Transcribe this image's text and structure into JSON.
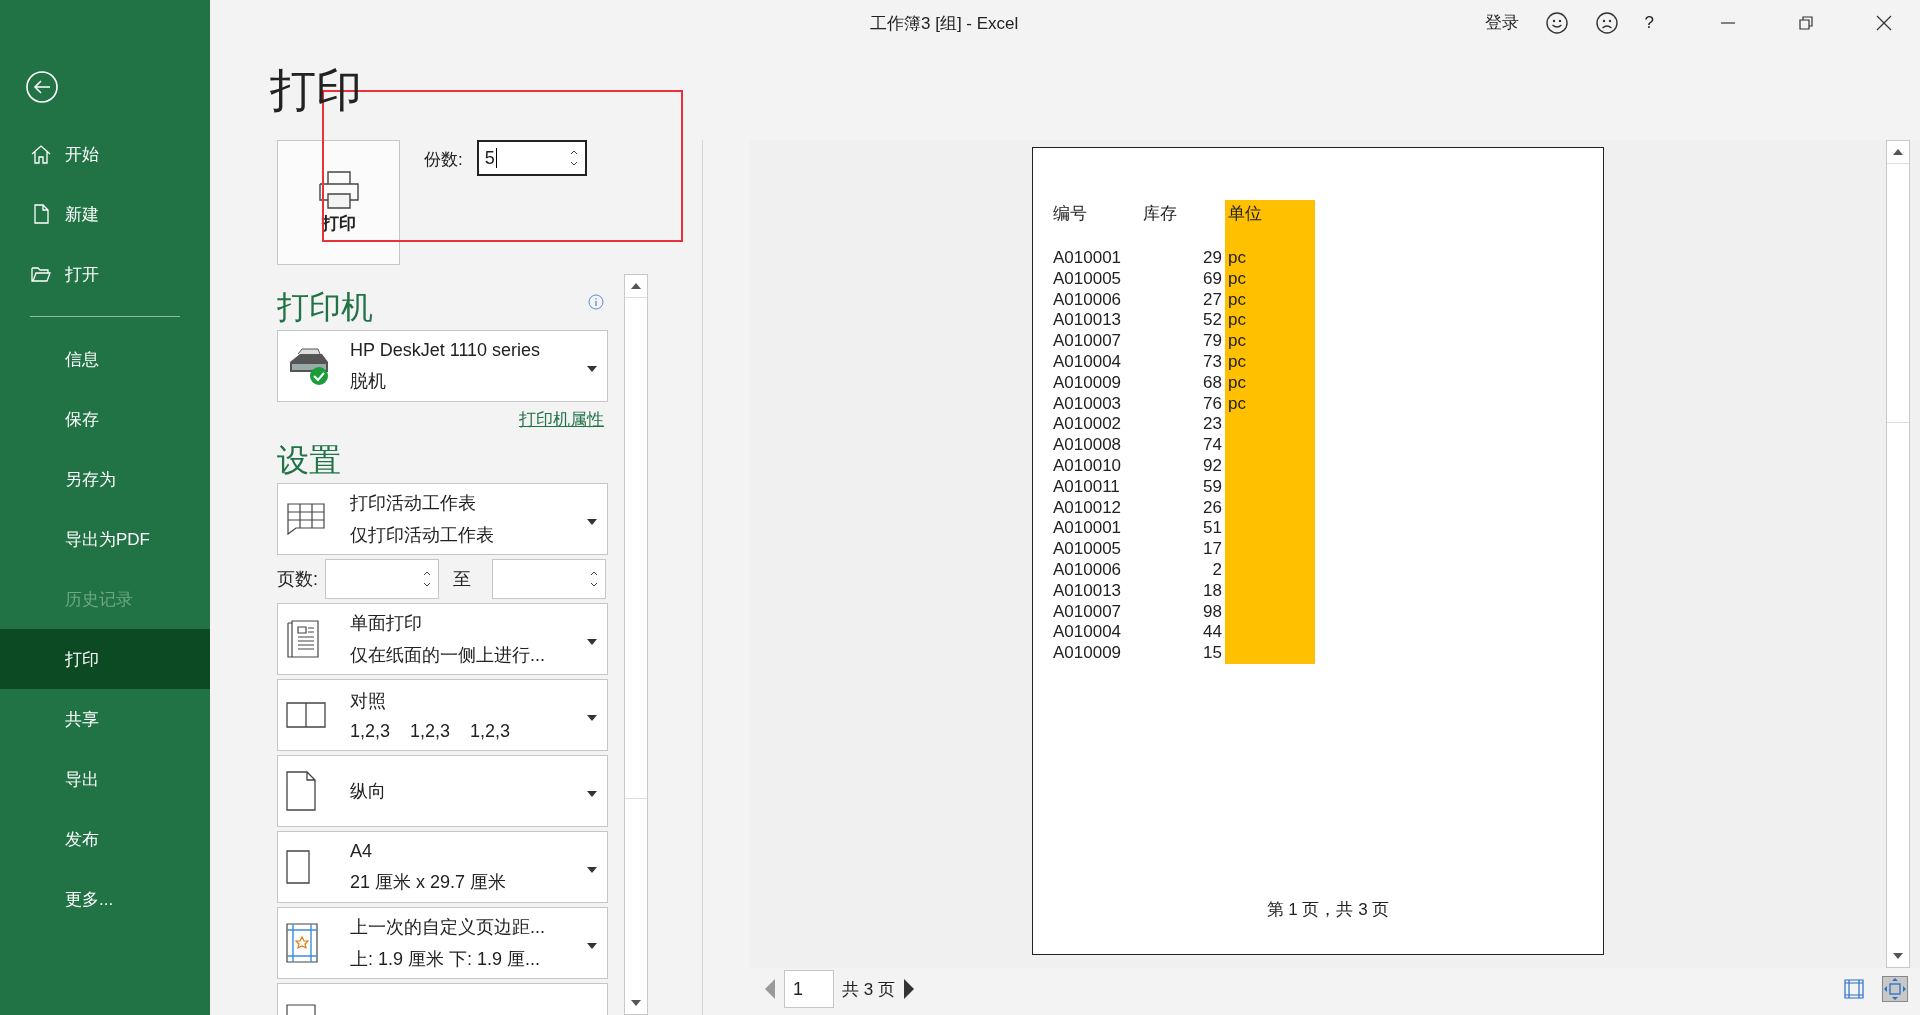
{
  "title_bar": {
    "title": "工作簿3  [组]  -  Excel",
    "sign_in": "登录",
    "help": "?"
  },
  "sidebar": {
    "top_items": [
      {
        "kind": "home",
        "label": "开始",
        "selected": false,
        "disabled": false
      },
      {
        "kind": "new",
        "label": "新建",
        "selected": false,
        "disabled": false
      },
      {
        "kind": "open",
        "label": "打开",
        "selected": false,
        "disabled": false
      }
    ],
    "items": [
      {
        "label": "信息",
        "selected": false,
        "disabled": false
      },
      {
        "label": "保存",
        "selected": false,
        "disabled": false
      },
      {
        "label": "另存为",
        "selected": false,
        "disabled": false
      },
      {
        "label": "导出为PDF",
        "selected": false,
        "disabled": false
      },
      {
        "label": "历史记录",
        "selected": false,
        "disabled": true
      },
      {
        "label": "打印",
        "selected": true,
        "disabled": false
      },
      {
        "label": "共享",
        "selected": false,
        "disabled": false
      },
      {
        "label": "导出",
        "selected": false,
        "disabled": false
      },
      {
        "label": "发布",
        "selected": false,
        "disabled": false
      },
      {
        "label": "更多...",
        "selected": false,
        "disabled": false
      }
    ]
  },
  "print": {
    "title": "打印",
    "print_button": "打印",
    "copies": {
      "label": "份数:",
      "value": "5"
    }
  },
  "printer": {
    "heading": "打印机",
    "name": "HP DeskJet 1110 series",
    "status": "脱机",
    "properties_link": "打印机属性"
  },
  "settings": {
    "heading": "设置",
    "pages": {
      "label": "页数:",
      "to_label": "至"
    },
    "options": [
      {
        "kind": "sheet",
        "line1": "打印活动工作表",
        "line2": "仅打印活动工作表"
      },
      {
        "kind": "pages"
      },
      {
        "kind": "sides",
        "line1": "单面打印",
        "line2": "仅在纸面的一侧上进行..."
      },
      {
        "kind": "collate",
        "line1": "对照",
        "line2": "1,2,3    1,2,3    1,2,3"
      },
      {
        "kind": "orientation",
        "line1": "纵向"
      },
      {
        "kind": "paper",
        "line1": "A4",
        "line2": "21 厘米 x 29.7 厘米"
      },
      {
        "kind": "margins",
        "line1": "上一次的自定义页边距...",
        "line2": "上: 1.9 厘米 下: 1.9 厘..."
      },
      {
        "kind": "scaling"
      }
    ]
  },
  "preview": {
    "columns": [
      "编号",
      "库存",
      "单位"
    ],
    "rows": [
      {
        "id": "A010001",
        "qty": "29",
        "unit": "pc"
      },
      {
        "id": "A010005",
        "qty": "69",
        "unit": "pc"
      },
      {
        "id": "A010006",
        "qty": "27",
        "unit": "pc"
      },
      {
        "id": "A010013",
        "qty": "52",
        "unit": "pc"
      },
      {
        "id": "A010007",
        "qty": "79",
        "unit": "pc"
      },
      {
        "id": "A010004",
        "qty": "73",
        "unit": "pc"
      },
      {
        "id": "A010009",
        "qty": "68",
        "unit": "pc"
      },
      {
        "id": "A010003",
        "qty": "76",
        "unit": "pc"
      },
      {
        "id": "A010002",
        "qty": "23"
      },
      {
        "id": "A010008",
        "qty": "74"
      },
      {
        "id": "A010010",
        "qty": "92"
      },
      {
        "id": "A010011",
        "qty": "59"
      },
      {
        "id": "A010012",
        "qty": "26"
      },
      {
        "id": "A010001",
        "qty": "51"
      },
      {
        "id": "A010005",
        "qty": "17"
      },
      {
        "id": "A010006",
        "qty": "2"
      },
      {
        "id": "A010013",
        "qty": "18"
      },
      {
        "id": "A010007",
        "qty": "98"
      },
      {
        "id": "A010004",
        "qty": "44"
      },
      {
        "id": "A010009",
        "qty": "15"
      }
    ],
    "footer": "第 1 页，共 3 页",
    "page_nav": {
      "current": "1",
      "total": "共 3 页"
    }
  }
}
